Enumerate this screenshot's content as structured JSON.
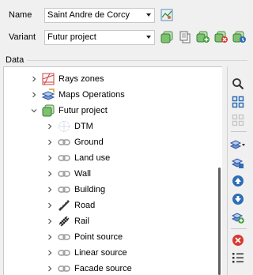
{
  "name": {
    "label": "Name",
    "value": "Saint Andre de Corcy"
  },
  "variant": {
    "label": "Variant",
    "value": "Futur project"
  },
  "section": {
    "label": "Data"
  },
  "tree": {
    "items": [
      {
        "label": "Rays zones",
        "icon": "rays-zones-icon",
        "level": 0,
        "expanded": false
      },
      {
        "label": "Maps Operations",
        "icon": "maps-operations-icon",
        "level": 0,
        "expanded": false
      },
      {
        "label": "Futur project",
        "icon": "variant-icon",
        "level": 0,
        "expanded": true
      },
      {
        "label": "DTM",
        "icon": "dtm-icon",
        "level": 1,
        "expanded": false
      },
      {
        "label": "Ground",
        "icon": "link-icon",
        "level": 1,
        "expanded": false
      },
      {
        "label": "Land use",
        "icon": "link-icon",
        "level": 1,
        "expanded": false
      },
      {
        "label": "Wall",
        "icon": "link-icon",
        "level": 1,
        "expanded": false
      },
      {
        "label": "Building",
        "icon": "link-icon",
        "level": 1,
        "expanded": false
      },
      {
        "label": "Road",
        "icon": "road-icon",
        "level": 1,
        "expanded": false
      },
      {
        "label": "Rail",
        "icon": "rail-icon",
        "level": 1,
        "expanded": false
      },
      {
        "label": "Point source",
        "icon": "link-icon",
        "level": 1,
        "expanded": false
      },
      {
        "label": "Linear source",
        "icon": "link-icon",
        "level": 1,
        "expanded": false
      },
      {
        "label": "Facade source",
        "icon": "link-icon",
        "level": 1,
        "expanded": false
      }
    ]
  },
  "colors": {
    "green": "#4caf50",
    "blue": "#2f6db5",
    "red": "#d9382f",
    "scroll_thumb": "#606060"
  }
}
